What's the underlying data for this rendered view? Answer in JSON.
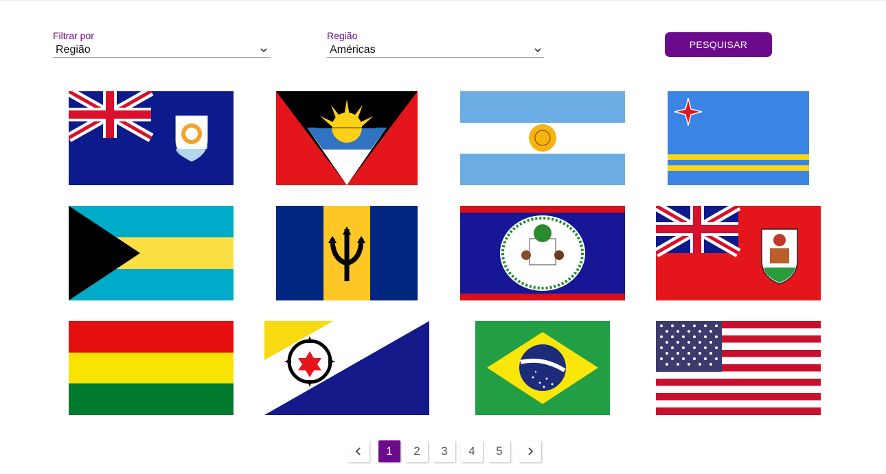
{
  "filters": {
    "filter_by": {
      "label": "Filtrar por",
      "value": "Região"
    },
    "region": {
      "label": "Região",
      "value": "Américas"
    },
    "search_label": "PESQUISAR"
  },
  "flags": [
    {
      "name": "anguilla",
      "icon": "flag-anguilla"
    },
    {
      "name": "antigua-and-barbuda",
      "icon": "flag-antigua-and-barbuda"
    },
    {
      "name": "argentina",
      "icon": "flag-argentina"
    },
    {
      "name": "aruba",
      "icon": "flag-aruba"
    },
    {
      "name": "bahamas",
      "icon": "flag-bahamas"
    },
    {
      "name": "barbados",
      "icon": "flag-barbados"
    },
    {
      "name": "belize",
      "icon": "flag-belize"
    },
    {
      "name": "bermuda",
      "icon": "flag-bermuda"
    },
    {
      "name": "bolivia",
      "icon": "flag-bolivia"
    },
    {
      "name": "bonaire",
      "icon": "flag-bonaire"
    },
    {
      "name": "brazil",
      "icon": "flag-brazil"
    },
    {
      "name": "united-states",
      "icon": "flag-united-states"
    }
  ],
  "pagination": {
    "pages": [
      "1",
      "2",
      "3",
      "4",
      "5"
    ],
    "current": "1"
  },
  "colors": {
    "accent": "#6c0a8c"
  }
}
